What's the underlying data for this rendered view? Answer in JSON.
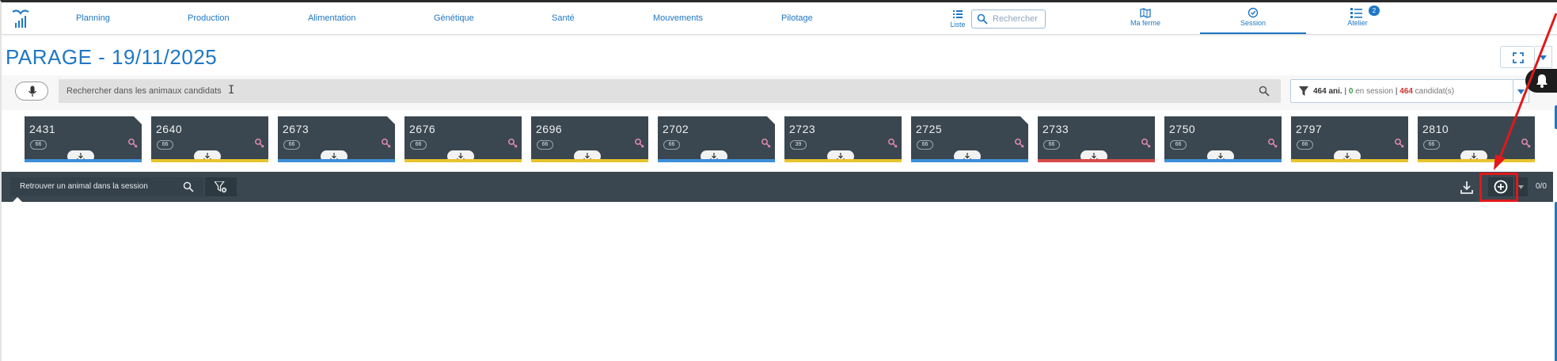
{
  "nav": {
    "items": [
      "Planning",
      "Production",
      "Alimentation",
      "Génétique",
      "Santé",
      "Mouvements",
      "Pilotage"
    ],
    "liste_label": "Liste",
    "search_placeholder": "Rechercher",
    "ma_ferme_label": "Ma ferme",
    "session_label": "Session",
    "atelier_label": "Atelier",
    "atelier_badge": "2"
  },
  "page_title": "PARAGE - 19/11/2025",
  "candidate_search": {
    "placeholder": "Rechercher dans les animaux candidats",
    "filter": {
      "animals": "464 ani.",
      "sep1": "|",
      "in_session_count": "0",
      "in_session_label": "en session",
      "sep2": "|",
      "candidates_count": "464",
      "candidates_label": "candidat(s)"
    }
  },
  "cards": [
    {
      "number": "2431",
      "age": "66",
      "stripe": "#3d8fd8",
      "fold": true
    },
    {
      "number": "2640",
      "age": "66",
      "stripe": "#e8c42c",
      "fold": false
    },
    {
      "number": "2673",
      "age": "66",
      "stripe": "#3d8fd8",
      "fold": true
    },
    {
      "number": "2676",
      "age": "66",
      "stripe": "#e8c42c",
      "fold": false
    },
    {
      "number": "2696",
      "age": "66",
      "stripe": "#e8c42c",
      "fold": false
    },
    {
      "number": "2702",
      "age": "66",
      "stripe": "#3d8fd8",
      "fold": true
    },
    {
      "number": "2723",
      "age": "39",
      "stripe": "#e8c42c",
      "fold": false
    },
    {
      "number": "2725",
      "age": "66",
      "stripe": "#3d8fd8",
      "fold": true
    },
    {
      "number": "2733",
      "age": "66",
      "stripe": "#d84a4a",
      "fold": false
    },
    {
      "number": "2750",
      "age": "66",
      "stripe": "#3d8fd8",
      "fold": false
    },
    {
      "number": "2797",
      "age": "66",
      "stripe": "#e8c42c",
      "fold": false
    },
    {
      "number": "2810",
      "age": "66",
      "stripe": "#e8c42c",
      "fold": false
    }
  ],
  "session_bar": {
    "search_placeholder": "Retrouver un animal dans la session",
    "counter": "0/0"
  },
  "colors": {
    "brand": "#1f77c4",
    "card_bg": "#3a4750",
    "highlight": "#e0191a"
  },
  "icons": {
    "logo": "farm-logo-icon",
    "liste": "list-icon",
    "search": "search-icon",
    "ma_ferme": "map-icon",
    "session": "session-check-icon",
    "atelier": "checklist-icon",
    "fullscreen": "fullscreen-icon",
    "bell": "bell-icon",
    "mic": "microphone-icon",
    "filter": "filter-icon",
    "download": "download-icon",
    "sex": "female-sex-icon",
    "add": "add-circle-icon",
    "filter_clear": "filter-clear-icon"
  }
}
